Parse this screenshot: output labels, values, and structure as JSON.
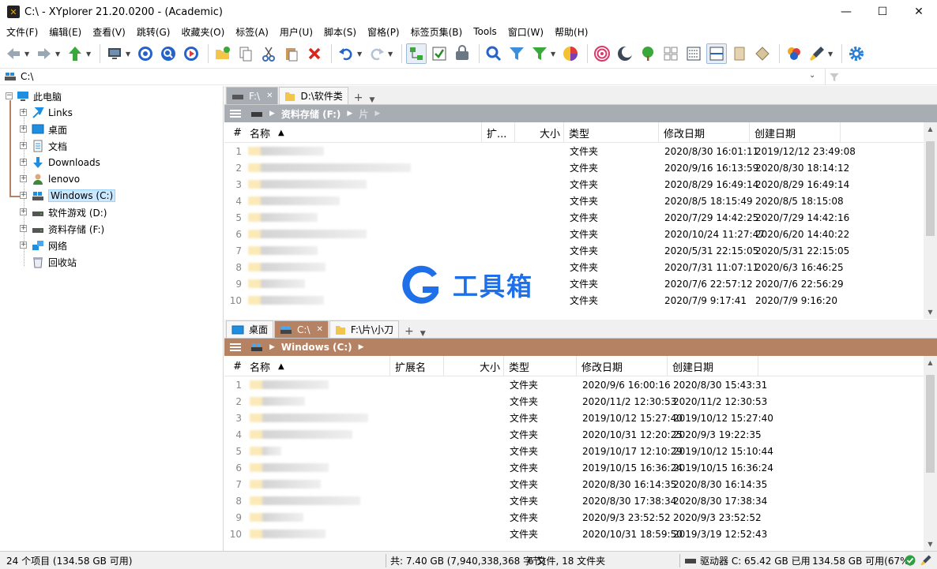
{
  "window": {
    "title": "C:\\ - XYplorer 21.20.0200 - (Academic)",
    "minimize": "—",
    "maximize": "☐",
    "close": "✕"
  },
  "menu": [
    "文件(F)",
    "编辑(E)",
    "查看(V)",
    "跳转(G)",
    "收藏夹(O)",
    "标签(A)",
    "用户(U)",
    "脚本(S)",
    "窗格(P)",
    "标签页集(B)",
    "Tools",
    "窗口(W)",
    "帮助(H)"
  ],
  "address": {
    "path": "C:\\"
  },
  "tree": {
    "items": [
      {
        "label": "此电脑",
        "icon": "computer-icon",
        "level": 0,
        "expander": "−"
      },
      {
        "label": "Links",
        "icon": "links-icon",
        "level": 1,
        "expander": "+"
      },
      {
        "label": "桌面",
        "icon": "desktop-icon",
        "level": 1,
        "expander": "+"
      },
      {
        "label": "文档",
        "icon": "documents-icon",
        "level": 1,
        "expander": "+"
      },
      {
        "label": "Downloads",
        "icon": "downloads-icon",
        "level": 1,
        "expander": "+"
      },
      {
        "label": "lenovo",
        "icon": "user-icon",
        "level": 1,
        "expander": "+"
      },
      {
        "label": "Windows (C:)",
        "icon": "system-drive-icon",
        "level": 1,
        "expander": "+",
        "selected": true
      },
      {
        "label": "软件游戏 (D:)",
        "icon": "drive-icon",
        "level": 1,
        "expander": "+"
      },
      {
        "label": "资料存储 (F:)",
        "icon": "drive-icon",
        "level": 1,
        "expander": "+"
      },
      {
        "label": "网络",
        "icon": "network-icon",
        "level": 1,
        "expander": "+"
      },
      {
        "label": "回收站",
        "icon": "recycle-bin-icon",
        "level": 1,
        "expander": ""
      }
    ]
  },
  "pane1": {
    "tabs": [
      {
        "label": "F:\\",
        "current": true
      },
      {
        "label": "D:\\软件类",
        "current": false
      }
    ],
    "tab_close": "✕",
    "tab_plus": "+",
    "tab_down": "▼",
    "breadcrumb": {
      "drive": "资料存储 (F:)",
      "folder": "片"
    },
    "columns": {
      "num": "#",
      "name": "名称",
      "ext": "扩...",
      "size": "大小",
      "type": "类型",
      "modified": "修改日期",
      "created": "创建日期"
    },
    "rows": [
      {
        "num": "1",
        "type": "文件夹",
        "modified": "2020/8/30 16:01:11",
        "created": "2019/12/12 23:49:08"
      },
      {
        "num": "2",
        "type": "文件夹",
        "modified": "2020/9/16 16:13:59",
        "created": "2020/8/30 18:14:12"
      },
      {
        "num": "3",
        "type": "文件夹",
        "modified": "2020/8/29 16:49:14",
        "created": "2020/8/29 16:49:14"
      },
      {
        "num": "4",
        "type": "文件夹",
        "modified": "2020/8/5 18:15:49",
        "created": "2020/8/5 18:15:08"
      },
      {
        "num": "5",
        "type": "文件夹",
        "modified": "2020/7/29 14:42:25",
        "created": "2020/7/29 14:42:16"
      },
      {
        "num": "6",
        "type": "文件夹",
        "modified": "2020/10/24 11:27:47",
        "created": "2020/6/20 14:40:22"
      },
      {
        "num": "7",
        "type": "文件夹",
        "modified": "2020/5/31 22:15:05",
        "created": "2020/5/31 22:15:05"
      },
      {
        "num": "8",
        "type": "文件夹",
        "modified": "2020/7/31 11:07:11",
        "created": "2020/6/3 16:46:25"
      },
      {
        "num": "9",
        "type": "文件夹",
        "modified": "2020/7/6 22:57:12",
        "created": "2020/7/6 22:56:29"
      },
      {
        "num": "10",
        "type": "文件夹",
        "modified": "2020/7/9 9:17:41",
        "created": "2020/7/9 9:16:20"
      }
    ]
  },
  "pane2": {
    "tabs": [
      {
        "label": "桌面",
        "current": false
      },
      {
        "label": "C:\\",
        "current": true
      },
      {
        "label": "F:\\片\\小刀",
        "current": false
      }
    ],
    "tab_close": "✕",
    "tab_plus": "+",
    "tab_down": "▼",
    "breadcrumb": {
      "drive": "Windows (C:)"
    },
    "columns": {
      "num": "#",
      "name": "名称",
      "ext": "扩展名",
      "size": "大小",
      "type": "类型",
      "modified": "修改日期",
      "created": "创建日期"
    },
    "rows": [
      {
        "num": "1",
        "type": "文件夹",
        "modified": "2020/9/6 16:00:16",
        "created": "2020/8/30 15:43:31"
      },
      {
        "num": "2",
        "type": "文件夹",
        "modified": "2020/11/2 12:30:53",
        "created": "2020/11/2 12:30:53"
      },
      {
        "num": "3",
        "type": "文件夹",
        "modified": "2019/10/12 15:27:40",
        "created": "2019/10/12 15:27:40"
      },
      {
        "num": "4",
        "type": "文件夹",
        "modified": "2020/10/31 12:20:25",
        "created": "2020/9/3 19:22:35"
      },
      {
        "num": "5",
        "type": "文件夹",
        "modified": "2019/10/17 12:10:29",
        "created": "2019/10/12 15:10:44"
      },
      {
        "num": "6",
        "type": "文件夹",
        "modified": "2019/10/15 16:36:24",
        "created": "2019/10/15 16:36:24"
      },
      {
        "num": "7",
        "type": "文件夹",
        "modified": "2020/8/30 16:14:35",
        "created": "2020/8/30 16:14:35"
      },
      {
        "num": "8",
        "type": "文件夹",
        "modified": "2020/8/30 17:38:34",
        "created": "2020/8/30 17:38:34"
      },
      {
        "num": "9",
        "type": "文件夹",
        "modified": "2020/9/3 23:52:52",
        "created": "2020/9/3 23:52:52"
      },
      {
        "num": "10",
        "type": "文件夹",
        "modified": "2020/10/31 18:59:50",
        "created": "2019/3/19 12:52:43"
      }
    ]
  },
  "watermark": {
    "text": "工具箱"
  },
  "status": {
    "items": "24 个项目 (134.58 GB 可用)",
    "total": "共: 7.40 GB (7,940,338,368 字节)",
    "counts": "6 文件, 18 文件夹",
    "drive": "驱动器 C:  65.42 GB 已用",
    "free": "134.58 GB 可用(67%)"
  },
  "colors": {
    "pane1_accent": "#a8adb4",
    "pane2_accent": "#b58363",
    "selection": "#cce8ff",
    "watermark": "#1e6fe8"
  }
}
